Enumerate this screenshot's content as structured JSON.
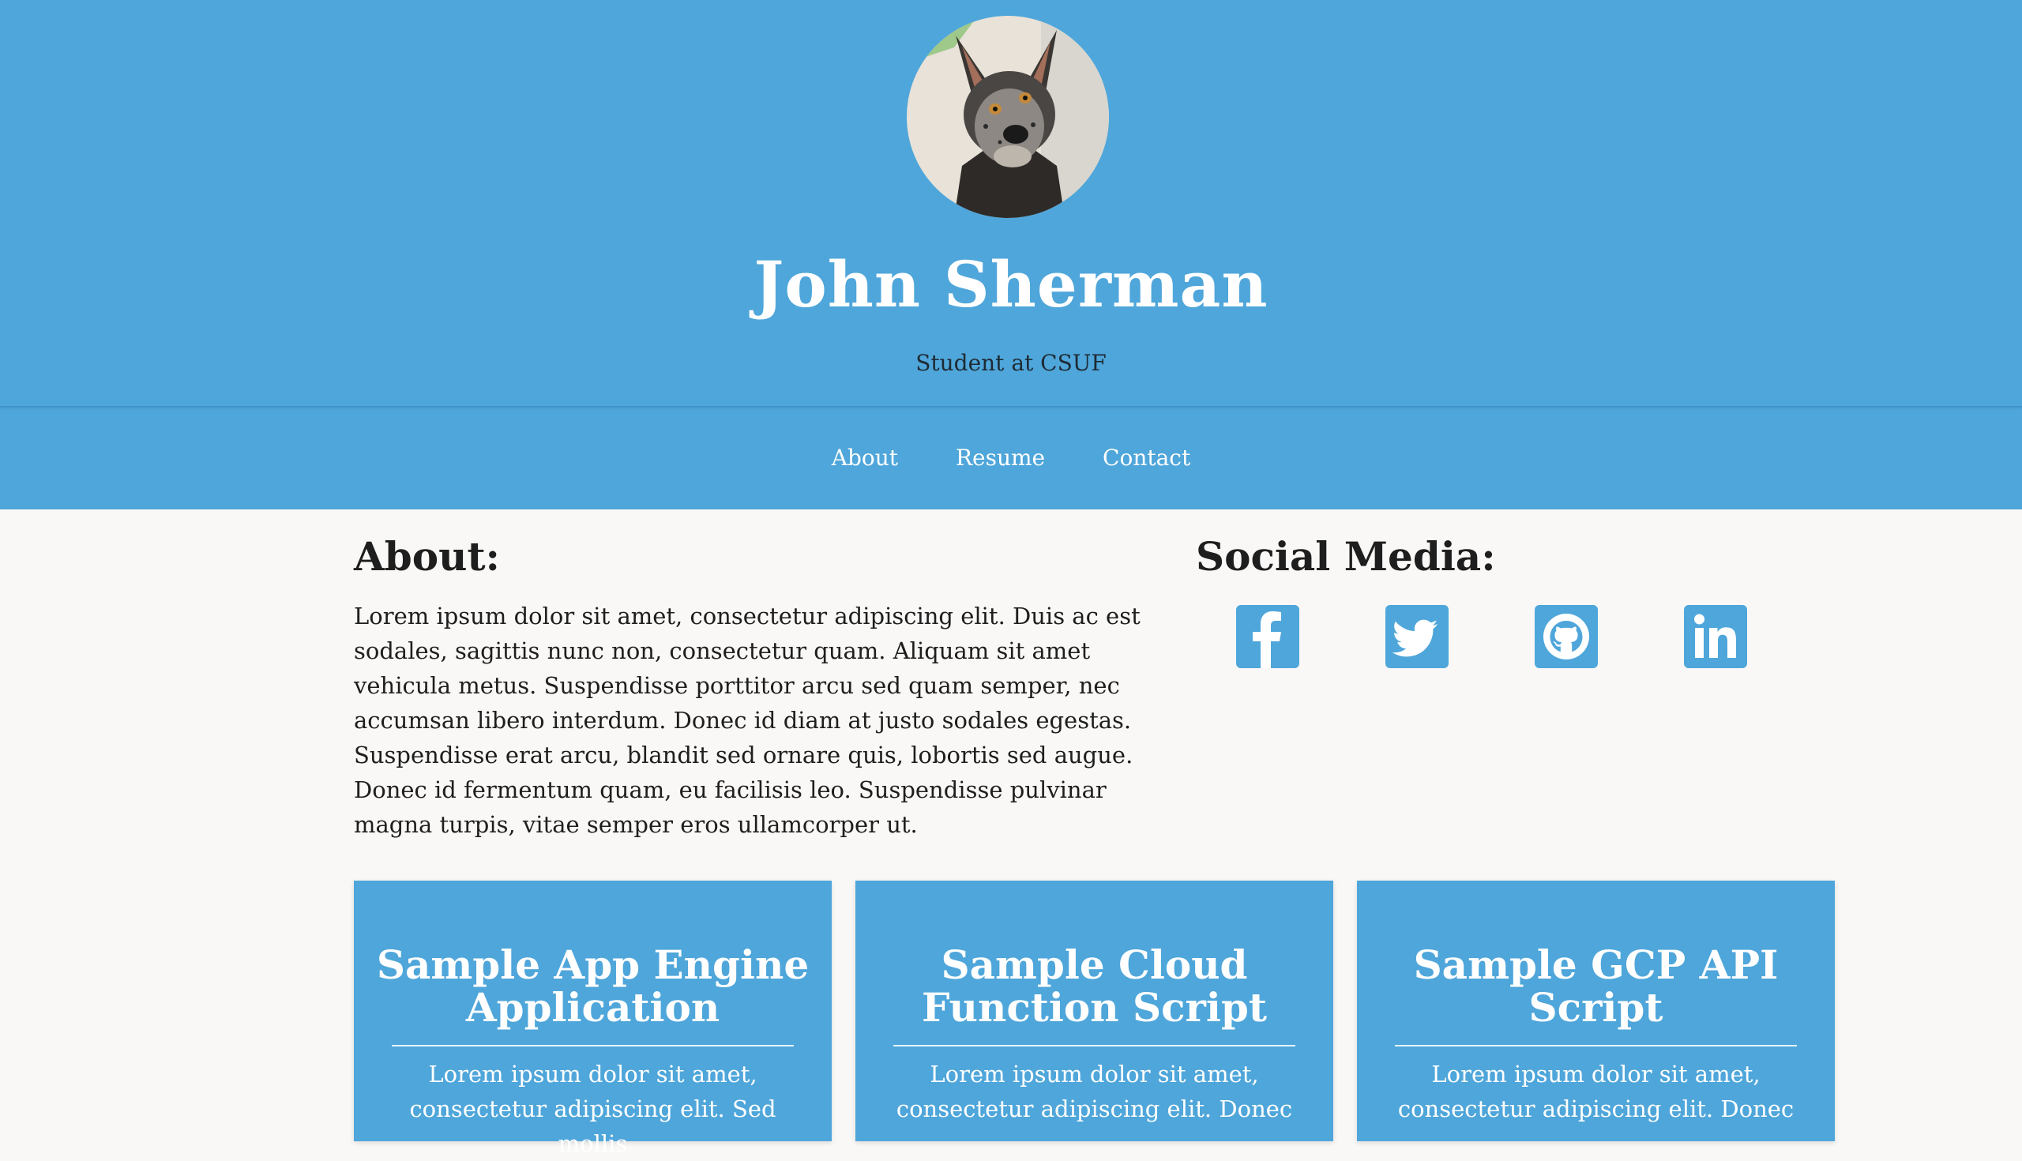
{
  "header": {
    "name": "John Sherman",
    "tagline": "Student at CSUF",
    "avatar_alt": "dog profile photo"
  },
  "nav": {
    "items": [
      "About",
      "Resume",
      "Contact"
    ]
  },
  "about": {
    "heading": "About:",
    "text": "Lorem ipsum dolor sit amet, consectetur adipiscing elit. Duis ac est sodales, sagittis nunc non, consectetur quam. Aliquam sit amet vehicula metus. Suspendisse porttitor arcu sed quam semper, nec accumsan libero interdum. Donec id diam at justo sodales egestas. Suspendisse erat arcu, blandit sed ornare quis, lobortis sed augue. Donec id fermentum quam, eu facilisis leo. Suspendisse pulvinar magna turpis, vitae semper eros ullamcorper ut."
  },
  "social": {
    "heading": "Social Media:",
    "icons": [
      "facebook-icon",
      "twitter-icon",
      "github-icon",
      "linkedin-icon"
    ]
  },
  "projects": [
    {
      "title": "Sample App Engine Application",
      "text": "Lorem ipsum dolor sit amet, consectetur adipiscing elit. Sed mollis"
    },
    {
      "title": "Sample Cloud Function Script",
      "text": "Lorem ipsum dolor sit amet, consectetur adipiscing elit. Donec"
    },
    {
      "title": "Sample GCP API Script",
      "text": "Lorem ipsum dolor sit amet, consectetur adipiscing elit. Donec"
    }
  ],
  "colors": {
    "accent": "#4fa6da",
    "background": "#f9f8f6",
    "text": "#1e1e1e"
  }
}
